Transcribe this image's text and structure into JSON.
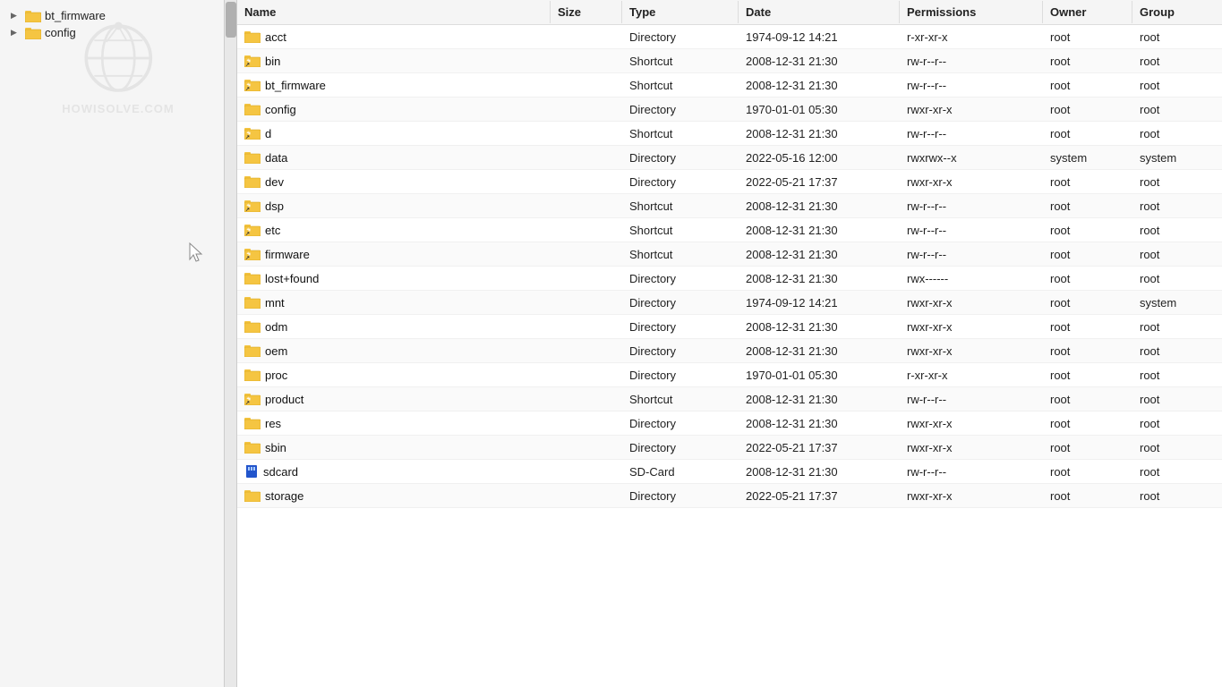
{
  "sidebar": {
    "watermark_brand": "HOWISOLVE.COM",
    "tree_items": [
      {
        "label": "bt_firmware",
        "indent": 1,
        "expanded": false
      },
      {
        "label": "config",
        "indent": 1,
        "expanded": false
      }
    ]
  },
  "table": {
    "columns": [
      {
        "id": "name",
        "label": "Name"
      },
      {
        "id": "size",
        "label": "Size"
      },
      {
        "id": "type",
        "label": "Type"
      },
      {
        "id": "date",
        "label": "Date"
      },
      {
        "id": "permissions",
        "label": "Permissions"
      },
      {
        "id": "owner",
        "label": "Owner"
      },
      {
        "id": "group",
        "label": "Group"
      }
    ],
    "rows": [
      {
        "name": "acct",
        "size": "",
        "type": "Directory",
        "date": "1974-09-12 14:21",
        "permissions": "r-xr-xr-x",
        "owner": "root",
        "group": "root",
        "icon": "folder"
      },
      {
        "name": "bin",
        "size": "",
        "type": "Shortcut",
        "date": "2008-12-31 21:30",
        "permissions": "rw-r--r--",
        "owner": "root",
        "group": "root",
        "icon": "shortcut"
      },
      {
        "name": "bt_firmware",
        "size": "",
        "type": "Shortcut",
        "date": "2008-12-31 21:30",
        "permissions": "rw-r--r--",
        "owner": "root",
        "group": "root",
        "icon": "shortcut"
      },
      {
        "name": "config",
        "size": "",
        "type": "Directory",
        "date": "1970-01-01 05:30",
        "permissions": "rwxr-xr-x",
        "owner": "root",
        "group": "root",
        "icon": "folder"
      },
      {
        "name": "d",
        "size": "",
        "type": "Shortcut",
        "date": "2008-12-31 21:30",
        "permissions": "rw-r--r--",
        "owner": "root",
        "group": "root",
        "icon": "shortcut"
      },
      {
        "name": "data",
        "size": "",
        "type": "Directory",
        "date": "2022-05-16 12:00",
        "permissions": "rwxrwx--x",
        "owner": "system",
        "group": "system",
        "icon": "folder"
      },
      {
        "name": "dev",
        "size": "",
        "type": "Directory",
        "date": "2022-05-21 17:37",
        "permissions": "rwxr-xr-x",
        "owner": "root",
        "group": "root",
        "icon": "folder"
      },
      {
        "name": "dsp",
        "size": "",
        "type": "Shortcut",
        "date": "2008-12-31 21:30",
        "permissions": "rw-r--r--",
        "owner": "root",
        "group": "root",
        "icon": "shortcut"
      },
      {
        "name": "etc",
        "size": "",
        "type": "Shortcut",
        "date": "2008-12-31 21:30",
        "permissions": "rw-r--r--",
        "owner": "root",
        "group": "root",
        "icon": "shortcut"
      },
      {
        "name": "firmware",
        "size": "",
        "type": "Shortcut",
        "date": "2008-12-31 21:30",
        "permissions": "rw-r--r--",
        "owner": "root",
        "group": "root",
        "icon": "shortcut"
      },
      {
        "name": "lost+found",
        "size": "",
        "type": "Directory",
        "date": "2008-12-31 21:30",
        "permissions": "rwx------",
        "owner": "root",
        "group": "root",
        "icon": "folder"
      },
      {
        "name": "mnt",
        "size": "",
        "type": "Directory",
        "date": "1974-09-12 14:21",
        "permissions": "rwxr-xr-x",
        "owner": "root",
        "group": "system",
        "icon": "folder"
      },
      {
        "name": "odm",
        "size": "",
        "type": "Directory",
        "date": "2008-12-31 21:30",
        "permissions": "rwxr-xr-x",
        "owner": "root",
        "group": "root",
        "icon": "folder"
      },
      {
        "name": "oem",
        "size": "",
        "type": "Directory",
        "date": "2008-12-31 21:30",
        "permissions": "rwxr-xr-x",
        "owner": "root",
        "group": "root",
        "icon": "folder"
      },
      {
        "name": "proc",
        "size": "",
        "type": "Directory",
        "date": "1970-01-01 05:30",
        "permissions": "r-xr-xr-x",
        "owner": "root",
        "group": "root",
        "icon": "folder"
      },
      {
        "name": "product",
        "size": "",
        "type": "Shortcut",
        "date": "2008-12-31 21:30",
        "permissions": "rw-r--r--",
        "owner": "root",
        "group": "root",
        "icon": "shortcut"
      },
      {
        "name": "res",
        "size": "",
        "type": "Directory",
        "date": "2008-12-31 21:30",
        "permissions": "rwxr-xr-x",
        "owner": "root",
        "group": "root",
        "icon": "folder"
      },
      {
        "name": "sbin",
        "size": "",
        "type": "Directory",
        "date": "2022-05-21 17:37",
        "permissions": "rwxr-xr-x",
        "owner": "root",
        "group": "root",
        "icon": "folder"
      },
      {
        "name": "sdcard",
        "size": "",
        "type": "SD-Card",
        "date": "2008-12-31 21:30",
        "permissions": "rw-r--r--",
        "owner": "root",
        "group": "root",
        "icon": "sdcard"
      },
      {
        "name": "storage",
        "size": "",
        "type": "Directory",
        "date": "2022-05-21 17:37",
        "permissions": "rwxr-xr-x",
        "owner": "root",
        "group": "root",
        "icon": "folder"
      }
    ]
  }
}
